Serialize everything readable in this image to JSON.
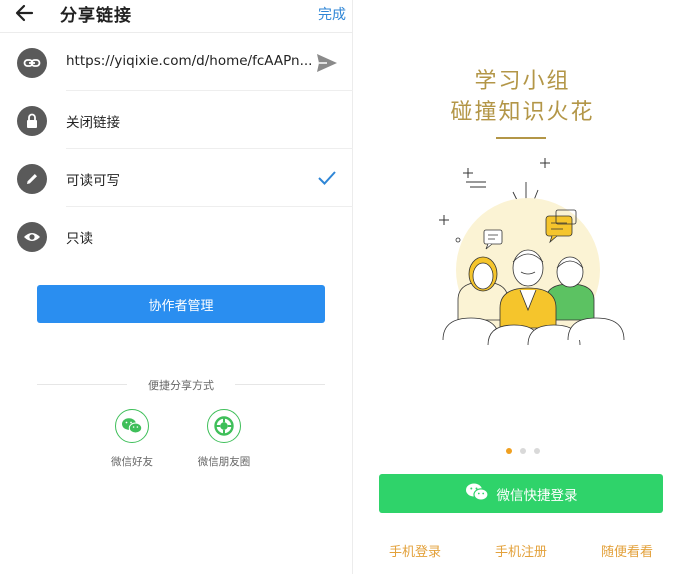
{
  "share_panel": {
    "title": "分享链接",
    "done_label": "完成",
    "link_url": "https://yiqixie.com/d/home/fcAAPn...",
    "options": [
      {
        "label": "关闭链接",
        "icon": "lock-icon",
        "selected": false
      },
      {
        "label": "可读可写",
        "icon": "pencil-icon",
        "selected": true
      },
      {
        "label": "只读",
        "icon": "eye-icon",
        "selected": false
      }
    ],
    "collaborator_button": "协作者管理",
    "quick_share_label": "便捷分享方式",
    "share_targets": [
      {
        "label": "微信好友",
        "icon": "wechat-icon"
      },
      {
        "label": "微信朋友圈",
        "icon": "moments-icon"
      }
    ]
  },
  "login_panel": {
    "slogan_line1": "学习小组",
    "slogan_line2": "碰撞知识火花",
    "carousel_total": 3,
    "carousel_active": 1,
    "wechat_login_label": "微信快捷登录",
    "phone_login": "手机登录",
    "phone_register": "手机注册",
    "browse_label": "随便看看"
  },
  "colors": {
    "primary_blue": "#2a8ef0",
    "link_blue": "#2f86d6",
    "wechat_green": "#2fd36a",
    "gold": "#b39647",
    "orange": "#e3a13b",
    "icon_gray": "#5a5a5a"
  }
}
